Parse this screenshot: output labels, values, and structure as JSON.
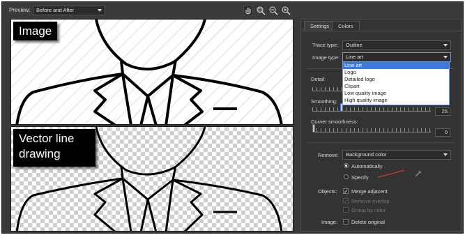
{
  "toolbar": {
    "preview_label": "Preview:",
    "preview_value": "Before and After",
    "tools": [
      "hand-icon",
      "zoom-fit-icon",
      "zoom-out-icon",
      "zoom-in-icon"
    ]
  },
  "canvas": {
    "top_caption": "Image",
    "bottom_caption_line1": "Vector line",
    "bottom_caption_line2": "drawing"
  },
  "tabs": {
    "settings": "Settings",
    "colors": "Colors"
  },
  "settings": {
    "trace_type_label": "Trace type:",
    "trace_type_value": "Outline",
    "image_type_label": "Image type:",
    "image_type_value": "Line art",
    "image_type_options": [
      "Line art",
      "Logo",
      "Detailed logo",
      "Clipart",
      "Low quality image",
      "High quality image"
    ],
    "detail_label": "Detail:",
    "smoothing_label": "Smoothing:",
    "smoothing_value": "25",
    "corner_label": "Corner smoothness:",
    "corner_value": "0",
    "remove_label": "Remove:",
    "remove_value": "Background color",
    "auto_label": "Automatically",
    "specify_label": "Specify",
    "objects_label": "Objects:",
    "merge_label": "Merge adjacent",
    "overlap_label": "Remove overlap",
    "group_label": "Group by color",
    "image_label": "Image:",
    "delete_label": "Delete original"
  }
}
